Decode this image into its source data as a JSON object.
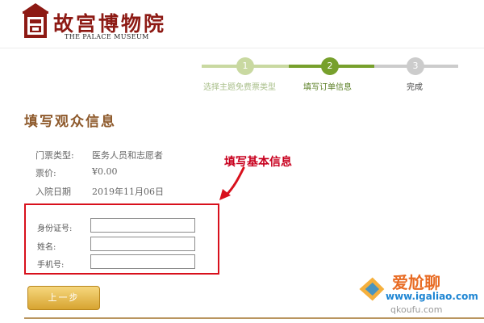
{
  "header": {
    "logo_cn": "故宫博物院",
    "logo_en": "THE PALACE MUSEUM"
  },
  "steps": [
    {
      "number": "1",
      "label": "选择主题免费票类型",
      "state": "done"
    },
    {
      "number": "2",
      "label": "填写订单信息",
      "state": "active"
    },
    {
      "number": "3",
      "label": "完成",
      "state": "pending"
    }
  ],
  "section_title": "填写观众信息",
  "ticket_info": [
    {
      "label": "门票类型:",
      "value": "医务人员和志愿者"
    },
    {
      "label": "票价:",
      "value": "¥0.00"
    },
    {
      "label": "入院日期",
      "value": "2019年11月06日"
    }
  ],
  "annotation": "填写基本信息",
  "form": {
    "fields": [
      {
        "label": "身份证号:",
        "value": ""
      },
      {
        "label": "姓名:",
        "value": ""
      },
      {
        "label": "手机号:",
        "value": ""
      }
    ]
  },
  "prev_button": "上一步",
  "watermark": {
    "text_cn": "爱尬聊",
    "url": "www.igaliao.com",
    "sub": "qkoufu.com"
  },
  "colors": {
    "brand": "#8d1a14",
    "step_done": "#c9d9a1",
    "step_active": "#77a02c",
    "step_pending": "#cccccc",
    "annotation": "#c8001e",
    "title": "#8e5a2c"
  },
  "icons": {
    "logo": "palace-museum-emblem-icon",
    "annotation_arrow": "red-arrow-icon"
  }
}
